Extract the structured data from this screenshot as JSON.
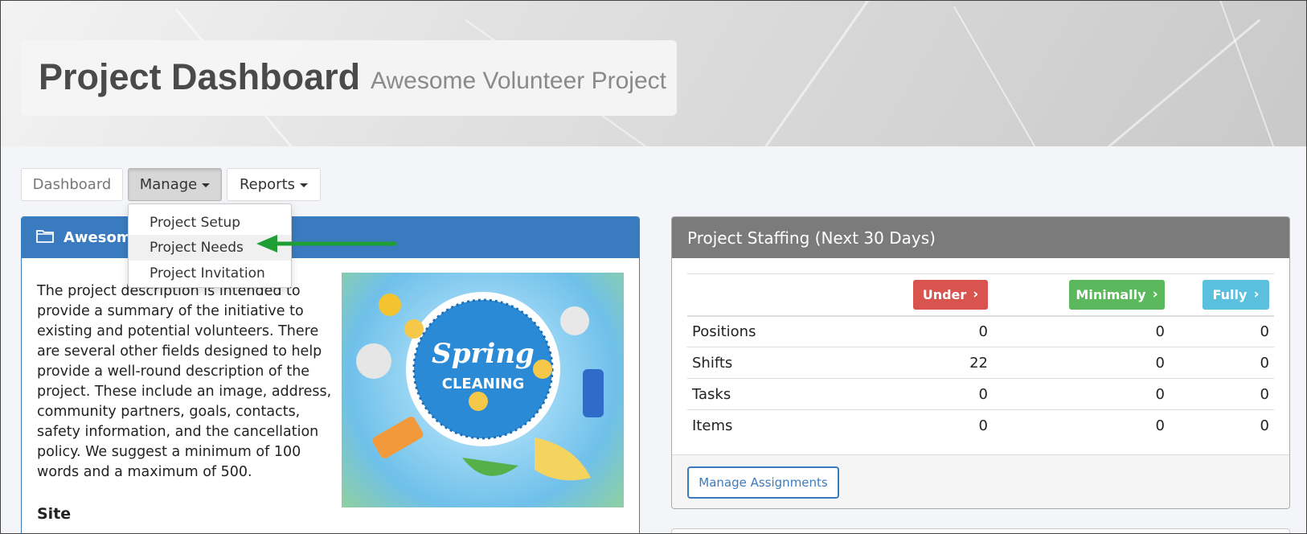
{
  "header": {
    "title": "Project Dashboard",
    "subtitle": "Awesome Volunteer Project"
  },
  "nav": {
    "dashboard_label": "Dashboard",
    "manage_label": "Manage",
    "reports_label": "Reports"
  },
  "manage_menu": {
    "items": [
      {
        "label": "Project Setup"
      },
      {
        "label": "Project Needs"
      },
      {
        "label": "Project Invitation"
      }
    ]
  },
  "project_panel": {
    "title": "Awesome",
    "icon": "folder-icon",
    "description": "The project description is intended to provide a summary of the initiative to existing and potential volunteers. There are several other fields designed to help provide a well-round description of the project. These include an image, address, community partners, goals, contacts, safety information, and the cancellation policy. We suggest a minimum of 100 words and a maximum of 500.",
    "site_label": "Site",
    "image_text_line1": "Spring",
    "image_text_line2": "CLEANING"
  },
  "staffing": {
    "title": "Project Staffing (Next 30 Days)",
    "columns": [
      {
        "label": "Under",
        "color": "#d9534f"
      },
      {
        "label": "Minimally",
        "color": "#5cb85c"
      },
      {
        "label": "Fully",
        "color": "#5bc0de"
      }
    ],
    "rows": [
      {
        "label": "Positions",
        "under": "0",
        "minimally": "0",
        "fully": "0"
      },
      {
        "label": "Shifts",
        "under": "22",
        "minimally": "0",
        "fully": "0"
      },
      {
        "label": "Tasks",
        "under": "0",
        "minimally": "0",
        "fully": "0"
      },
      {
        "label": "Items",
        "under": "0",
        "minimally": "0",
        "fully": "0"
      }
    ],
    "manage_assignments_label": "Manage Assignments"
  },
  "colors": {
    "primary_blue": "#3a7bbf",
    "panel_gray": "#7b7b7b",
    "annotation_arrow": "#1e9e35"
  }
}
